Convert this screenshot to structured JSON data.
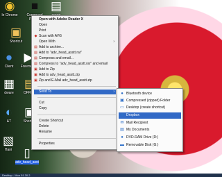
{
  "desktop": {
    "icons": [
      {
        "name": "google-chrome-icon",
        "label": "le Chrome",
        "glyph": "◉",
        "color": "#f2c230"
      },
      {
        "name": "command-prompt-icon",
        "label": "Command Prompt",
        "glyph": "■",
        "color": "#111"
      },
      {
        "name": "report-icon",
        "label": "report",
        "glyph": "▤",
        "color": "#ffffff"
      },
      {
        "name": "shortcut-icon",
        "label": "Shortcut",
        "glyph": "▣",
        "color": "#f0c25b"
      },
      {
        "name": "client-icon",
        "label": "Client",
        "glyph": "●",
        "color": "#4a90e2"
      },
      {
        "name": "freemake-icon",
        "label": "Freemake",
        "glyph": "▶",
        "color": "#ffffff"
      },
      {
        "name": "hardware-icon",
        "label": "dware",
        "glyph": "▦",
        "color": "#ffffff"
      },
      {
        "name": "office-icon",
        "label": "OFFICE",
        "glyph": "▤",
        "color": "#f0c25b"
      },
      {
        "name": "at-icon",
        "label": "&T",
        "glyph": "◐",
        "color": "#59a8ff"
      },
      {
        "name": "shortcut2-icon",
        "label": "Shortcut",
        "glyph": "▣",
        "color": "#ffffff"
      },
      {
        "name": "hani-icon",
        "label": "Hani",
        "glyph": "▧",
        "color": "#ffffff"
      },
      {
        "name": "adv-head-asst-icon",
        "label": "adv_head_asst",
        "glyph": "▯",
        "color": "#ffffff"
      }
    ]
  },
  "context_menu": {
    "items": [
      {
        "name": "open-with-adobe-reader-x",
        "label": "Open with Adobe Reader X",
        "bold": true,
        "icon": ""
      },
      {
        "name": "open",
        "label": "Open",
        "icon": ""
      },
      {
        "name": "print",
        "label": "Print",
        "icon": ""
      },
      {
        "name": "scan-with-avg",
        "label": "Scan with AVG",
        "icon": "◆"
      },
      {
        "name": "open-with",
        "label": "Open With",
        "icon": "",
        "arrow": "›"
      },
      {
        "name": "add-to-archive",
        "label": "Add to archive...",
        "icon": "▤"
      },
      {
        "name": "add-to-adv-head-asstt-rar",
        "label": "Add to \"adv_head_asstt.rar\"",
        "icon": "▤"
      },
      {
        "name": "compress-and-email",
        "label": "Compress and email...",
        "icon": "▤"
      },
      {
        "name": "compress-to-rar-and-email",
        "label": "Compress to \"adv_head_asstt.rar\" and email",
        "icon": "▤"
      },
      {
        "name": "add-to-zip",
        "label": "Add to Zip",
        "icon": "▣"
      },
      {
        "name": "add-to-adv-head-asstt-zip",
        "label": "Add to adv_head_asstt.zip",
        "icon": "▣"
      },
      {
        "name": "zip-and-email",
        "label": "Zip and E-Mail adv_head_asstt.zip",
        "icon": "▣"
      },
      {
        "name": "send-to",
        "label": "Send To",
        "icon": "",
        "arrow": "›",
        "active": true
      },
      {
        "name": "cut",
        "label": "Cut",
        "icon": ""
      },
      {
        "name": "copy",
        "label": "Copy",
        "icon": ""
      },
      {
        "name": "create-shortcut",
        "label": "Create Shortcut",
        "icon": ""
      },
      {
        "name": "delete",
        "label": "Delete",
        "icon": ""
      },
      {
        "name": "rename",
        "label": "Rename",
        "icon": ""
      },
      {
        "name": "properties",
        "label": "Properties",
        "icon": ""
      }
    ]
  },
  "send_to_menu": {
    "items": [
      {
        "name": "bluetooth-device",
        "label": "Bluetooth device",
        "icon": "●"
      },
      {
        "name": "compressed-zipped-folder",
        "label": "Compressed (zipped) Folder",
        "icon": "▣"
      },
      {
        "name": "desktop-create-shortcut",
        "label": "Desktop (create shortcut)",
        "icon": "▭"
      },
      {
        "name": "dropbox",
        "label": "Dropbox",
        "icon": "◆",
        "active": true
      },
      {
        "name": "mail-recipient",
        "label": "Mail Recipient",
        "icon": "✉"
      },
      {
        "name": "my-documents",
        "label": "My Documents",
        "icon": "▤"
      },
      {
        "name": "dvd-ram-drive-d",
        "label": "DVD-RAM Drive (D:)",
        "icon": "●"
      },
      {
        "name": "removable-disk-g",
        "label": "Removable Disk (G:)",
        "icon": "▬"
      }
    ]
  },
  "taskbar": {
    "text": "Desktop - Mon 01 30 2"
  }
}
